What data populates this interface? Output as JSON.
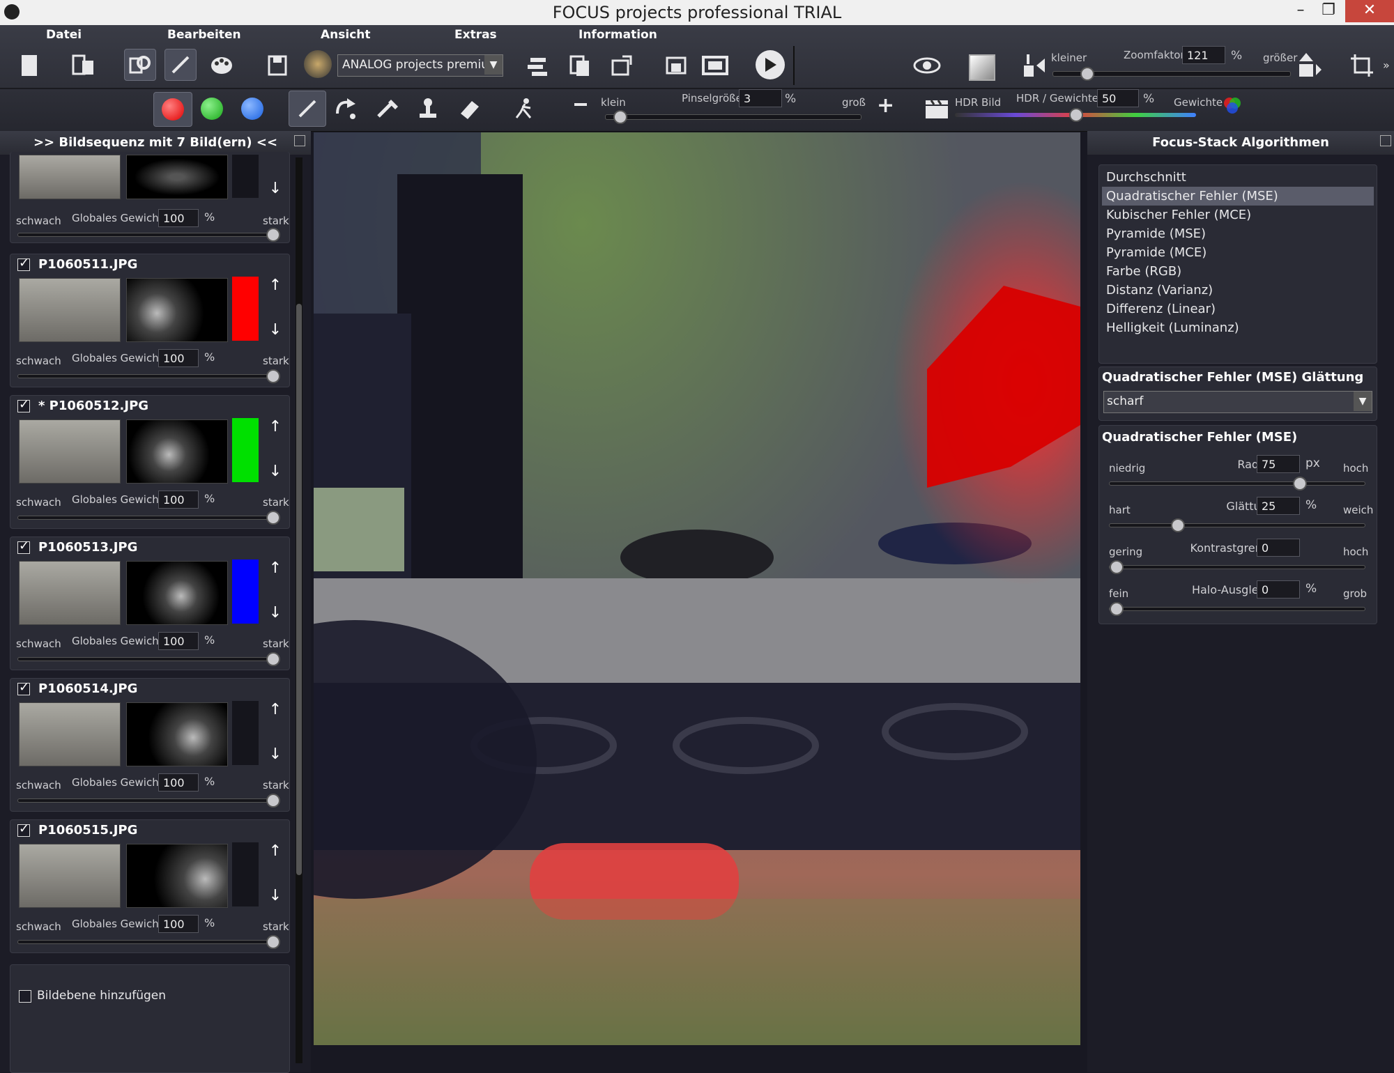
{
  "window": {
    "title": "FOCUS projects professional  TRIAL",
    "minimize": "–",
    "maximize": "❐",
    "close": "✕"
  },
  "menu": [
    "Datei",
    "Bearbeiten",
    "Ansicht",
    "Extras",
    "Information"
  ],
  "toolbar1": {
    "preset": "ANALOG projects premium",
    "zoom_small": "kleiner",
    "zoom_label": "Zoomfaktor",
    "zoom_value": "121",
    "zoom_unit": "%",
    "zoom_large": "größer",
    "zoom_level": 0.12
  },
  "toolbar2": {
    "brush_small": "klein",
    "brush_size_label": "Pinselgröße",
    "brush_size": "3",
    "brush_unit": "%",
    "brush_large": "groß",
    "brush_level": 0.03,
    "hdr_label": "HDR Bild",
    "hdr_weight_label": "HDR / Gewichte",
    "hdr_weight": "50",
    "hdr_unit": "%",
    "weights_label": "Gewichte",
    "hdr_level": 0.5
  },
  "left_panel": {
    "header": ">> Bildsequenz mit 7 Bild(ern) <<",
    "weak": "schwach",
    "global_weight": "Globales Gewicht",
    "strong": "stark",
    "percent": "%",
    "partial_weight": "100",
    "images": [
      {
        "name": "P1060511.JPG",
        "weight": "100",
        "channel": "#ff0000"
      },
      {
        "name": "* P1060512.JPG",
        "weight": "100",
        "channel": "#00e000"
      },
      {
        "name": "P1060513.JPG",
        "weight": "100",
        "channel": "#0000ff"
      },
      {
        "name": "P1060514.JPG",
        "weight": "100",
        "channel": "#15151c"
      },
      {
        "name": "P1060515.JPG",
        "weight": "100",
        "channel": "#15151c"
      }
    ],
    "add_layer": "Bildebene hinzufügen"
  },
  "right_panel": {
    "header": "Focus-Stack Algorithmen",
    "algorithms": [
      "Durchschnitt",
      "Quadratischer Fehler (MSE)",
      "Kubischer Fehler (MCE)",
      "Pyramide (MSE)",
      "Pyramide (MCE)",
      "Farbe (RGB)",
      "Distanz (Varianz)",
      "Differenz (Linear)",
      "Helligkeit (Luminanz)"
    ],
    "selected_index": 1,
    "smoothing_title": "Quadratischer Fehler (MSE) Glättung",
    "smoothing_value": "scharf",
    "params_title": "Quadratischer Fehler (MSE)",
    "params": [
      {
        "left": "niedrig",
        "label": "Radius",
        "value": "75",
        "unit": "px",
        "right": "hoch",
        "level": 0.75
      },
      {
        "left": "hart",
        "label": "Glättung",
        "value": "25",
        "unit": "%",
        "right": "weich",
        "level": 0.25
      },
      {
        "left": "gering",
        "label": "Kontrastgrenze",
        "value": "0",
        "unit": "",
        "right": "hoch",
        "level": 0.0
      },
      {
        "left": "fein",
        "label": "Halo-Ausgleich",
        "value": "0",
        "unit": "%",
        "right": "grob",
        "level": 0.0
      }
    ]
  }
}
